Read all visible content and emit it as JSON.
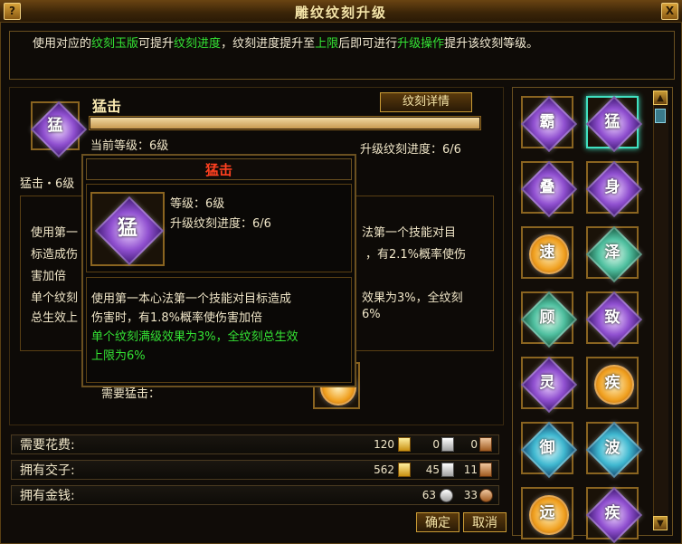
{
  "window": {
    "title": "雕纹纹刻升级",
    "help": "?",
    "close": "X"
  },
  "description": {
    "parts": [
      "使用对应的",
      "纹刻玉版",
      "可提升",
      "纹刻进度",
      "，纹刻进度提升至",
      "上限",
      "后即可进行",
      "升级操作",
      "提升该纹刻等级。"
    ]
  },
  "skill": {
    "name": "猛击",
    "icon_char": "猛",
    "detail_button": "纹刻详情",
    "current_level": "当前等级：6级",
    "progress_text": "升级纹刻进度：6/6",
    "progress": 1.0,
    "summary": "猛击・6级",
    "desc_line1": "使用第一",
    "desc_line1_right": "法第一个技能对目",
    "desc_line2": "标造成伤",
    "desc_line2_right": "，有2.1%概率使伤",
    "desc_line3": "害加倍",
    "green_line1": "单个纹刻",
    "green_line1_right": "效果为3%，全纹刻",
    "green_line2": "总生效上",
    "green_line2_right": "6%",
    "need_label": "需要猛击：",
    "need_icon_char": "猛"
  },
  "tooltip": {
    "title": "猛击",
    "icon_char": "猛",
    "level": "等级：6级",
    "progress": "升级纹刻进度：6/6",
    "desc1": "使用第一本心法第一个技能对目标造成",
    "desc2": "伤害时，有1.8%概率使伤害加倍",
    "green1": "单个纹刻满级效果为3%，全纹刻总生效",
    "green2": "上限为6%"
  },
  "costs": {
    "required": {
      "label": "需要花费:",
      "gold": "120",
      "silver": "0",
      "copper": "0"
    },
    "owned_items": {
      "label": "拥有交子:",
      "gold": "562",
      "silver": "45",
      "copper": "11"
    },
    "owned_money": {
      "label": "拥有金钱:",
      "silver_coin": "63",
      "copper_coin": "33"
    }
  },
  "buttons": {
    "confirm": "确定",
    "cancel": "取消"
  },
  "glyphs": [
    {
      "char": "霸",
      "color": "purple"
    },
    {
      "char": "猛",
      "color": "purple",
      "selected": true
    },
    {
      "char": "叠",
      "color": "purple"
    },
    {
      "char": "身",
      "color": "purple"
    },
    {
      "char": "速",
      "color": "orange"
    },
    {
      "char": "泽",
      "color": "green"
    },
    {
      "char": "顾",
      "color": "green"
    },
    {
      "char": "致",
      "color": "purple"
    },
    {
      "char": "灵",
      "color": "purple"
    },
    {
      "char": "疾",
      "color": "orange"
    },
    {
      "char": "御",
      "color": "cyan"
    },
    {
      "char": "波",
      "color": "cyan"
    },
    {
      "char": "远",
      "color": "orange"
    },
    {
      "char": "疾",
      "color": "purple"
    }
  ]
}
